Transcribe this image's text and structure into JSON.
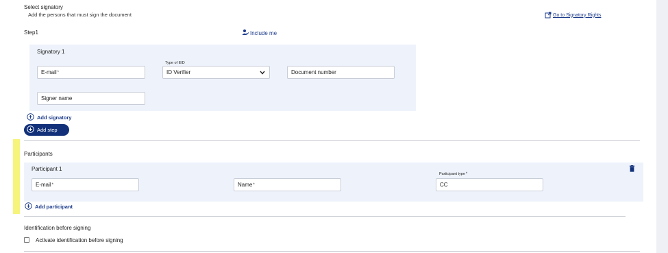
{
  "signatory_section": {
    "title": "Select signatory",
    "subtitle": "Add the persons that must sign the document",
    "rights_link": "Go to Signatory Rights",
    "step_label": "Step1",
    "include_me": "Include me",
    "signatory_title": "Signatory 1",
    "email_placeholder": "E-mail",
    "email_required": "*",
    "eid_label": "Type of EID",
    "eid_value": "ID Verifier",
    "document_number_placeholder": "Document number",
    "signer_name_placeholder": "Signer name",
    "add_signatory": "Add signatory",
    "add_step": "Add step"
  },
  "participants_section": {
    "title": "Participants",
    "participant_title": "Participant 1",
    "email_placeholder": "E-mail",
    "email_required": "*",
    "name_placeholder": "Name",
    "name_required": "*",
    "type_label": "Participant type",
    "type_required": "*",
    "type_value": "CC",
    "add_participant": "Add participant"
  },
  "identification_section": {
    "title": "Identification before signing",
    "checkbox_label": "Activate identification before signing",
    "checked": false
  },
  "colors": {
    "accent": "#12317a",
    "link": "#1b3a8a",
    "panel": "#eef3fb",
    "highlight": "#f6f47a"
  },
  "icons": {
    "rights_link": "external-link-icon",
    "include_me": "person-check-icon",
    "add": "plus-circle-icon",
    "delete": "trash-icon",
    "select": "chevron-down-icon"
  }
}
